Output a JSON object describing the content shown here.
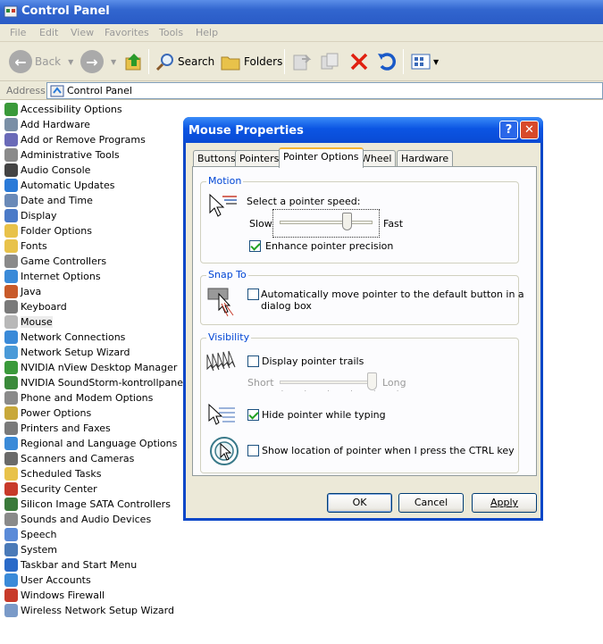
{
  "window": {
    "title": "Control Panel"
  },
  "menu": [
    "File",
    "Edit",
    "View",
    "Favorites",
    "Tools",
    "Help"
  ],
  "toolbar": {
    "back": "Back",
    "search": "Search",
    "folders": "Folders"
  },
  "address": {
    "label": "Address",
    "value": "Control Panel"
  },
  "control_panel_items": [
    {
      "label": "Accessibility Options",
      "icon": "accessibility-icon",
      "color": "#3a9a3a"
    },
    {
      "label": "Add Hardware",
      "icon": "add-hardware-icon",
      "color": "#7a8fa6"
    },
    {
      "label": "Add or Remove Programs",
      "icon": "add-remove-programs-icon",
      "color": "#6a6ab8"
    },
    {
      "label": "Administrative Tools",
      "icon": "admin-tools-icon",
      "color": "#8a8a8a"
    },
    {
      "label": "Audio Console",
      "icon": "audio-console-icon",
      "color": "#444444"
    },
    {
      "label": "Automatic Updates",
      "icon": "automatic-updates-icon",
      "color": "#2a7ad8"
    },
    {
      "label": "Date and Time",
      "icon": "date-time-icon",
      "color": "#6a8ab8"
    },
    {
      "label": "Display",
      "icon": "display-icon",
      "color": "#4a7ac8"
    },
    {
      "label": "Folder Options",
      "icon": "folder-options-icon",
      "color": "#e8c24a"
    },
    {
      "label": "Fonts",
      "icon": "fonts-icon",
      "color": "#e8c24a"
    },
    {
      "label": "Game Controllers",
      "icon": "game-controllers-icon",
      "color": "#8a8a8a"
    },
    {
      "label": "Internet Options",
      "icon": "internet-options-icon",
      "color": "#3a8ad8"
    },
    {
      "label": "Java",
      "icon": "java-icon",
      "color": "#c85a2a"
    },
    {
      "label": "Keyboard",
      "icon": "keyboard-icon",
      "color": "#7a7a7a"
    },
    {
      "label": "Mouse",
      "icon": "mouse-icon",
      "color": "#b8b8b8"
    },
    {
      "label": "Network Connections",
      "icon": "network-connections-icon",
      "color": "#3a8ad8"
    },
    {
      "label": "Network Setup Wizard",
      "icon": "network-wizard-icon",
      "color": "#4a9ad8"
    },
    {
      "label": "NVIDIA nView Desktop Manager",
      "icon": "nvidia-nview-icon",
      "color": "#3a9a3a"
    },
    {
      "label": "NVIDIA SoundStorm-kontrollpane",
      "icon": "nvidia-soundstorm-icon",
      "color": "#3a8a3a"
    },
    {
      "label": "Phone and Modem Options",
      "icon": "phone-modem-icon",
      "color": "#8a8a8a"
    },
    {
      "label": "Power Options",
      "icon": "power-options-icon",
      "color": "#c8a83a"
    },
    {
      "label": "Printers and Faxes",
      "icon": "printers-faxes-icon",
      "color": "#7a7a7a"
    },
    {
      "label": "Regional and Language Options",
      "icon": "regional-options-icon",
      "color": "#3a8ad8"
    },
    {
      "label": "Scanners and Cameras",
      "icon": "scanners-cameras-icon",
      "color": "#6a6a6a"
    },
    {
      "label": "Scheduled Tasks",
      "icon": "scheduled-tasks-icon",
      "color": "#e8c24a"
    },
    {
      "label": "Security Center",
      "icon": "security-center-icon",
      "color": "#c83a2a"
    },
    {
      "label": "Silicon Image SATA Controllers",
      "icon": "sata-controllers-icon",
      "color": "#3a7a3a"
    },
    {
      "label": "Sounds and Audio Devices",
      "icon": "sounds-audio-icon",
      "color": "#8a8a8a"
    },
    {
      "label": "Speech",
      "icon": "speech-icon",
      "color": "#5a8ad8"
    },
    {
      "label": "System",
      "icon": "system-icon",
      "color": "#4a7ab8"
    },
    {
      "label": "Taskbar and Start Menu",
      "icon": "taskbar-icon",
      "color": "#2a6ac8"
    },
    {
      "label": "User Accounts",
      "icon": "user-accounts-icon",
      "color": "#3a8ad8"
    },
    {
      "label": "Windows Firewall",
      "icon": "windows-firewall-icon",
      "color": "#c83a2a"
    },
    {
      "label": "Wireless Network Setup Wizard",
      "icon": "wireless-wizard-icon",
      "color": "#7a9ac8"
    }
  ],
  "dialog": {
    "title": "Mouse Properties",
    "tabs": [
      "Buttons",
      "Pointers",
      "Pointer Options",
      "Wheel",
      "Hardware"
    ],
    "active_tab": "Pointer Options",
    "motion": {
      "group": "Motion",
      "speed_label": "Select a pointer speed:",
      "slow": "Slow",
      "fast": "Fast",
      "speed_value_fraction": 0.73,
      "precision_label": "Enhance pointer precision",
      "precision_checked": true
    },
    "snap": {
      "group": "Snap To",
      "label_line1": "Automatically move pointer to the default button in a",
      "label_line2": "dialog box",
      "checked": false
    },
    "visibility": {
      "group": "Visibility",
      "trails_label": "Display pointer trails",
      "trails_checked": false,
      "short": "Short",
      "long": "Long",
      "trails_value_fraction": 1.0,
      "hide_label": "Hide pointer while typing",
      "hide_checked": true,
      "ctrl_label": "Show location of pointer when I press the CTRL key",
      "ctrl_checked": false
    },
    "buttons": {
      "ok": "OK",
      "cancel": "Cancel",
      "apply": "Apply"
    }
  }
}
